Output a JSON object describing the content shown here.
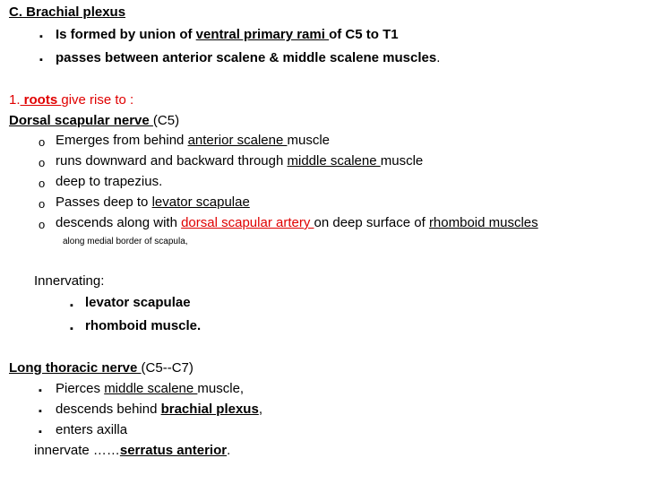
{
  "slide": {
    "background_color": "#ffffff",
    "text_color": "#000000",
    "accent_color": "#e00000",
    "title": "C. Brachial plexus",
    "top_bullets": [
      {
        "marker": "square-bullet",
        "pre": "Is formed by union of ",
        "emph": "ventral primary rami ",
        "post": "of C5 to T1"
      },
      {
        "marker": "square-bullet",
        "pre": "passes between anterior scalene  &  middle scalene muscles",
        "emph": "",
        "post": "."
      }
    ],
    "section_1": {
      "lead_number": "1.",
      "lead_emph": " roots ",
      "lead_rest": "give rise to :",
      "nerve_name": "Dorsal scapular nerve ",
      "nerve_roots": "(C5)",
      "items": [
        {
          "marker": "circle-bullet",
          "pre": "Emerges from behind ",
          "emph": "anterior scalene ",
          "emph_color": "#000000",
          "post": "muscle",
          "emph2": "",
          "post2": ""
        },
        {
          "marker": "circle-bullet",
          "pre": "runs downward and backward through ",
          "emph": "middle scalene ",
          "emph_color": "#000000",
          "post": "muscle",
          "emph2": "",
          "post2": ""
        },
        {
          "marker": "circle-bullet",
          "pre": "deep to trapezius.",
          "emph": "",
          "emph_color": "#000000",
          "post": "",
          "emph2": "",
          "post2": ""
        },
        {
          "marker": "circle-bullet",
          "pre": "Passes deep to ",
          "emph": "levator scapulae",
          "emph_color": "#000000",
          "post": "",
          "emph2": "",
          "post2": ""
        },
        {
          "marker": "circle-bullet",
          "pre": "descends along with ",
          "emph": "dorsal scapular artery ",
          "emph_color": "#e00000",
          "post": "on deep surface of ",
          "emph2": "rhomboid muscles",
          "post2": ""
        }
      ],
      "footnote": "along medial border of scapula,",
      "innervating_label": "Innervating:",
      "innervating_items": [
        {
          "marker": "square-bullet",
          "text": "levator scapulae"
        },
        {
          "marker": "square-bullet",
          "text": "rhomboid muscle."
        }
      ]
    },
    "section_2": {
      "nerve_name": "Long thoracic nerve ",
      "nerve_roots": "(C5--C7)",
      "items": [
        {
          "marker": "square-bullet",
          "pre": "Pierces ",
          "emph": "middle scalene ",
          "emph_style": "underline",
          "post": "muscle,"
        },
        {
          "marker": "square-bullet",
          "pre": "descends behind ",
          "emph": "brachial plexus",
          "emph_style": "bold-underline",
          "post": ","
        },
        {
          "marker": "square-bullet",
          "pre": "enters axilla",
          "emph": "",
          "emph_style": "none",
          "post": ""
        }
      ],
      "final_line_pre": "innervate ……",
      "final_line_emph": "serratus anterior",
      "final_line_post": "."
    }
  }
}
